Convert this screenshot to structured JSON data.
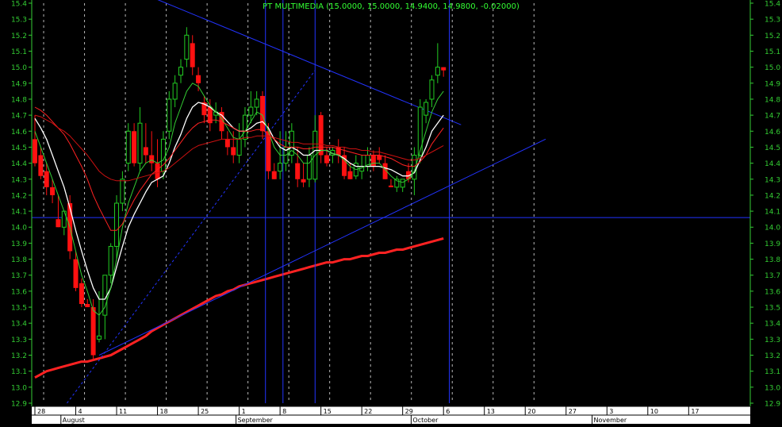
{
  "colors": {
    "background": "#000000",
    "axis": "#33cc33",
    "grid": "#d8d8d8",
    "trendline": "#2233ff",
    "candle_up": "#22cc22",
    "candle_down": "#ff1111",
    "ma_white": "#ffffff",
    "ma_green": "#33cc33",
    "ma_red": "#ff2222",
    "ma_darkred": "#cc1111",
    "title_color": "#33ff33",
    "xaxis_bg": "#ffffff",
    "xaxis_text": "#000000"
  },
  "chart_data": {
    "type": "candlestick",
    "title": "PT MULTIMEDIA (15.0000, 15.0000, 14.9400, 14.9800, -0.02000)",
    "ylim": [
      12.9,
      15.4
    ],
    "y_ticks": [
      "12.9",
      "13.0",
      "13.1",
      "13.2",
      "13.3",
      "13.4",
      "13.5",
      "13.6",
      "13.7",
      "13.8",
      "13.9",
      "14.0",
      "14.1",
      "14.2",
      "14.3",
      "14.4",
      "14.5",
      "14.6",
      "14.7",
      "14.8",
      "14.9",
      "15.0",
      "15.1",
      "15.2",
      "15.3",
      "15.4"
    ],
    "x_day_labels": [
      "28",
      "4",
      "11",
      "18",
      "25",
      "1",
      "8",
      "15",
      "22",
      "29",
      "6",
      "13",
      "20",
      "27",
      "3",
      "10",
      "17"
    ],
    "x_month_labels": [
      "August",
      "September",
      "October",
      "November"
    ],
    "grid": "vertical dotted at week boundaries",
    "candles": [
      {
        "o": 14.55,
        "h": 14.7,
        "l": 14.38,
        "c": 14.4
      },
      {
        "o": 14.45,
        "h": 14.5,
        "l": 14.3,
        "c": 14.32
      },
      {
        "o": 14.35,
        "h": 14.4,
        "l": 14.2,
        "c": 14.25
      },
      {
        "o": 14.25,
        "h": 14.3,
        "l": 14.15,
        "c": 14.2
      },
      {
        "o": 14.05,
        "h": 14.2,
        "l": 14.0,
        "c": 14.0
      },
      {
        "o": 14.0,
        "h": 14.1,
        "l": 13.95,
        "c": 14.1
      },
      {
        "o": 14.15,
        "h": 14.2,
        "l": 13.8,
        "c": 13.85
      },
      {
        "o": 13.8,
        "h": 13.85,
        "l": 13.6,
        "c": 13.62
      },
      {
        "o": 13.65,
        "h": 13.68,
        "l": 13.5,
        "c": 13.52
      },
      {
        "o": 13.52,
        "h": 13.55,
        "l": 13.5,
        "c": 13.5
      },
      {
        "o": 13.5,
        "h": 13.55,
        "l": 13.17,
        "c": 13.2
      },
      {
        "o": 13.3,
        "h": 13.6,
        "l": 13.28,
        "c": 13.32
      },
      {
        "o": 13.45,
        "h": 13.7,
        "l": 13.3,
        "c": 13.7
      },
      {
        "o": 13.7,
        "h": 13.9,
        "l": 13.65,
        "c": 13.88
      },
      {
        "o": 13.88,
        "h": 14.2,
        "l": 13.8,
        "c": 14.15
      },
      {
        "o": 14.15,
        "h": 14.35,
        "l": 14.1,
        "c": 14.3
      },
      {
        "o": 14.4,
        "h": 14.65,
        "l": 14.35,
        "c": 14.6
      },
      {
        "o": 14.6,
        "h": 14.65,
        "l": 14.38,
        "c": 14.4
      },
      {
        "o": 14.4,
        "h": 14.75,
        "l": 14.35,
        "c": 14.65
      },
      {
        "o": 14.5,
        "h": 14.65,
        "l": 14.4,
        "c": 14.45
      },
      {
        "o": 14.45,
        "h": 14.6,
        "l": 14.35,
        "c": 14.4
      },
      {
        "o": 14.4,
        "h": 14.55,
        "l": 14.25,
        "c": 14.3
      },
      {
        "o": 14.35,
        "h": 14.6,
        "l": 14.3,
        "c": 14.55
      },
      {
        "o": 14.6,
        "h": 14.85,
        "l": 14.55,
        "c": 14.8
      },
      {
        "o": 14.8,
        "h": 14.95,
        "l": 14.75,
        "c": 14.9
      },
      {
        "o": 14.95,
        "h": 15.05,
        "l": 14.9,
        "c": 15.0
      },
      {
        "o": 15.05,
        "h": 15.25,
        "l": 15.0,
        "c": 15.2
      },
      {
        "o": 15.15,
        "h": 15.2,
        "l": 14.95,
        "c": 15.0
      },
      {
        "o": 14.95,
        "h": 15.0,
        "l": 14.85,
        "c": 14.9
      },
      {
        "o": 14.78,
        "h": 14.82,
        "l": 14.65,
        "c": 14.7
      },
      {
        "o": 14.75,
        "h": 14.8,
        "l": 14.6,
        "c": 14.65
      },
      {
        "o": 14.7,
        "h": 14.78,
        "l": 14.65,
        "c": 14.72
      },
      {
        "o": 14.72,
        "h": 14.75,
        "l": 14.55,
        "c": 14.6
      },
      {
        "o": 14.55,
        "h": 14.6,
        "l": 14.45,
        "c": 14.5
      },
      {
        "o": 14.5,
        "h": 14.6,
        "l": 14.4,
        "c": 14.45
      },
      {
        "o": 14.45,
        "h": 14.65,
        "l": 14.4,
        "c": 14.55
      },
      {
        "o": 14.55,
        "h": 14.75,
        "l": 14.5,
        "c": 14.7
      },
      {
        "o": 14.7,
        "h": 14.85,
        "l": 14.65,
        "c": 14.75
      },
      {
        "o": 14.75,
        "h": 14.85,
        "l": 14.7,
        "c": 14.8
      },
      {
        "o": 14.82,
        "h": 14.85,
        "l": 14.55,
        "c": 14.6
      },
      {
        "o": 14.6,
        "h": 14.65,
        "l": 14.3,
        "c": 14.35
      },
      {
        "o": 14.35,
        "h": 14.4,
        "l": 14.3,
        "c": 14.3
      },
      {
        "o": 14.35,
        "h": 14.6,
        "l": 14.3,
        "c": 14.4
      },
      {
        "o": 14.4,
        "h": 14.6,
        "l": 14.35,
        "c": 14.5
      },
      {
        "o": 14.45,
        "h": 14.65,
        "l": 14.4,
        "c": 14.6
      },
      {
        "o": 14.4,
        "h": 14.5,
        "l": 14.25,
        "c": 14.3
      },
      {
        "o": 14.3,
        "h": 14.4,
        "l": 14.25,
        "c": 14.28
      },
      {
        "o": 14.3,
        "h": 14.5,
        "l": 14.25,
        "c": 14.45
      },
      {
        "o": 14.3,
        "h": 14.7,
        "l": 14.28,
        "c": 14.6
      },
      {
        "o": 14.7,
        "h": 14.72,
        "l": 14.4,
        "c": 14.45
      },
      {
        "o": 14.45,
        "h": 14.5,
        "l": 14.38,
        "c": 14.4
      },
      {
        "o": 14.45,
        "h": 14.5,
        "l": 14.4,
        "c": 14.48
      },
      {
        "o": 14.5,
        "h": 14.55,
        "l": 14.4,
        "c": 14.45
      },
      {
        "o": 14.45,
        "h": 14.5,
        "l": 14.3,
        "c": 14.32
      },
      {
        "o": 14.35,
        "h": 14.4,
        "l": 14.3,
        "c": 14.3
      },
      {
        "o": 14.32,
        "h": 14.45,
        "l": 14.3,
        "c": 14.4
      },
      {
        "o": 14.35,
        "h": 14.45,
        "l": 14.3,
        "c": 14.38
      },
      {
        "o": 14.38,
        "h": 14.5,
        "l": 14.35,
        "c": 14.45
      },
      {
        "o": 14.45,
        "h": 14.48,
        "l": 14.35,
        "c": 14.38
      },
      {
        "o": 14.45,
        "h": 14.5,
        "l": 14.4,
        "c": 14.42
      },
      {
        "o": 14.4,
        "h": 14.45,
        "l": 14.3,
        "c": 14.3
      },
      {
        "o": 14.26,
        "h": 14.3,
        "l": 14.25,
        "c": 14.25
      },
      {
        "o": 14.25,
        "h": 14.32,
        "l": 14.22,
        "c": 14.3
      },
      {
        "o": 14.25,
        "h": 14.3,
        "l": 14.22,
        "c": 14.3
      },
      {
        "o": 14.35,
        "h": 14.4,
        "l": 14.28,
        "c": 14.3
      },
      {
        "o": 14.3,
        "h": 14.5,
        "l": 14.2,
        "c": 14.45
      },
      {
        "o": 14.45,
        "h": 14.8,
        "l": 14.4,
        "c": 14.75
      },
      {
        "o": 14.7,
        "h": 14.8,
        "l": 14.65,
        "c": 14.78
      },
      {
        "o": 14.8,
        "h": 14.95,
        "l": 14.75,
        "c": 14.92
      },
      {
        "o": 14.95,
        "h": 15.15,
        "l": 14.9,
        "c": 15.0
      },
      {
        "o": 15.0,
        "h": 15.0,
        "l": 14.94,
        "c": 14.98
      }
    ],
    "moving_averages": [
      {
        "color_key": "ma_white",
        "width": 1.3,
        "values": [
          14.68,
          14.62,
          14.55,
          14.45,
          14.35,
          14.25,
          14.12,
          13.98,
          13.85,
          13.73,
          13.62,
          13.55,
          13.55,
          13.62,
          13.75,
          13.88,
          14.0,
          14.08,
          14.15,
          14.22,
          14.28,
          14.3,
          14.32,
          14.4,
          14.5,
          14.58,
          14.68,
          14.75,
          14.78,
          14.77,
          14.75,
          14.72,
          14.7,
          14.66,
          14.62,
          14.6,
          14.6,
          14.62,
          14.65,
          14.66,
          14.62,
          14.55,
          14.5,
          14.48,
          14.5,
          14.48,
          14.45,
          14.45,
          14.48,
          14.48,
          14.48,
          14.46,
          14.45,
          14.43,
          14.4,
          14.38,
          14.38,
          14.38,
          14.38,
          14.38,
          14.37,
          14.36,
          14.34,
          14.32,
          14.32,
          14.34,
          14.42,
          14.5,
          14.6,
          14.65,
          14.7
        ]
      },
      {
        "color_key": "ma_green",
        "width": 1,
        "values": [
          14.6,
          14.5,
          14.4,
          14.3,
          14.2,
          14.1,
          14.0,
          13.85,
          13.7,
          13.6,
          13.48,
          13.45,
          13.5,
          13.62,
          13.8,
          14.0,
          14.15,
          14.25,
          14.35,
          14.4,
          14.42,
          14.4,
          14.42,
          14.5,
          14.65,
          14.75,
          14.85,
          14.9,
          14.88,
          14.82,
          14.76,
          14.72,
          14.68,
          14.62,
          14.56,
          14.55,
          14.6,
          14.66,
          14.72,
          14.7,
          14.6,
          14.5,
          14.45,
          14.45,
          14.48,
          14.45,
          14.4,
          14.4,
          14.45,
          14.48,
          14.48,
          14.46,
          14.45,
          14.42,
          14.38,
          14.36,
          14.37,
          14.39,
          14.4,
          14.4,
          14.36,
          14.32,
          14.29,
          14.28,
          14.3,
          14.35,
          14.48,
          14.6,
          14.72,
          14.8,
          14.85
        ]
      },
      {
        "color_key": "ma_red",
        "width": 1,
        "values": [
          14.75,
          14.73,
          14.7,
          14.66,
          14.62,
          14.58,
          14.52,
          14.45,
          14.38,
          14.3,
          14.2,
          14.12,
          14.05,
          13.98,
          13.98,
          14.02,
          14.1,
          14.17,
          14.23,
          14.28,
          14.33,
          14.36,
          14.39,
          14.43,
          14.48,
          14.53,
          14.58,
          14.62,
          14.65,
          14.66,
          14.67,
          14.67,
          14.66,
          14.64,
          14.62,
          14.6,
          14.6,
          14.6,
          14.61,
          14.61,
          14.58,
          14.55,
          14.52,
          14.5,
          14.5,
          14.5,
          14.49,
          14.49,
          14.5,
          14.5,
          14.5,
          14.5,
          14.49,
          14.48,
          14.47,
          14.46,
          14.45,
          14.45,
          14.45,
          14.45,
          14.44,
          14.43,
          14.41,
          14.39,
          14.38,
          14.38,
          14.41,
          14.45,
          14.52,
          14.57,
          14.62
        ]
      },
      {
        "color_key": "ma_darkred",
        "width": 1,
        "values": [
          14.7,
          14.69,
          14.67,
          14.65,
          14.62,
          14.6,
          14.57,
          14.53,
          14.49,
          14.45,
          14.4,
          14.35,
          14.32,
          14.3,
          14.29,
          14.29,
          14.29,
          14.3,
          14.31,
          14.32,
          14.33,
          14.34,
          14.35,
          14.37,
          14.4,
          14.43,
          14.46,
          14.49,
          14.51,
          14.52,
          14.53,
          14.54,
          14.55,
          14.55,
          14.55,
          14.55,
          14.56,
          14.56,
          14.57,
          14.57,
          14.57,
          14.56,
          14.55,
          14.54,
          14.53,
          14.53,
          14.52,
          14.52,
          14.52,
          14.52,
          14.51,
          14.51,
          14.5,
          14.5,
          14.49,
          14.49,
          14.48,
          14.48,
          14.47,
          14.47,
          14.46,
          14.45,
          14.44,
          14.43,
          14.42,
          14.42,
          14.43,
          14.45,
          14.47,
          14.49,
          14.51
        ]
      },
      {
        "color_key": "ma_red",
        "width": 3,
        "values": [
          13.06,
          13.08,
          13.1,
          13.11,
          13.12,
          13.13,
          13.14,
          13.15,
          13.16,
          13.16,
          13.17,
          13.18,
          13.19,
          13.2,
          13.22,
          13.24,
          13.26,
          13.28,
          13.3,
          13.32,
          13.35,
          13.37,
          13.39,
          13.41,
          13.43,
          13.45,
          13.47,
          13.49,
          13.51,
          13.53,
          13.55,
          13.57,
          13.58,
          13.6,
          13.61,
          13.63,
          13.64,
          13.65,
          13.66,
          13.67,
          13.68,
          13.69,
          13.7,
          13.71,
          13.72,
          13.73,
          13.74,
          13.75,
          13.76,
          13.77,
          13.78,
          13.78,
          13.79,
          13.8,
          13.8,
          13.81,
          13.82,
          13.82,
          13.83,
          13.84,
          13.84,
          13.85,
          13.86,
          13.86,
          13.87,
          13.88,
          13.89,
          13.9,
          13.91,
          13.92,
          13.93
        ]
      }
    ],
    "trendlines": [
      {
        "x1": 20.5,
        "y1": 15.43,
        "x2": 73,
        "y2": 14.64,
        "dashed": false
      },
      {
        "x1": 11,
        "y1": 13.2,
        "x2": 87.5,
        "y2": 14.55,
        "dashed": false
      },
      {
        "x1": 5.5,
        "y1": 12.9,
        "x2": 48,
        "y2": 14.98,
        "dashed": true
      },
      {
        "x1": 0,
        "y1": 14.06,
        "x2": 92,
        "y2": 14.06,
        "dashed": false
      }
    ],
    "vertical_lines": [
      39.5,
      42.5,
      48,
      71
    ],
    "dotted_grid_x": [
      1.5,
      8.5,
      15.5,
      22.5,
      29.5,
      36.5,
      43.5,
      50.5,
      57.5,
      64.5,
      71.5,
      78.5,
      85.5
    ],
    "day_label_x": [
      0,
      7,
      14,
      21,
      28,
      35,
      42,
      49,
      56,
      63,
      70,
      77,
      84,
      91,
      98,
      105,
      112
    ],
    "month_label_x": [
      5,
      35,
      65,
      96
    ]
  }
}
